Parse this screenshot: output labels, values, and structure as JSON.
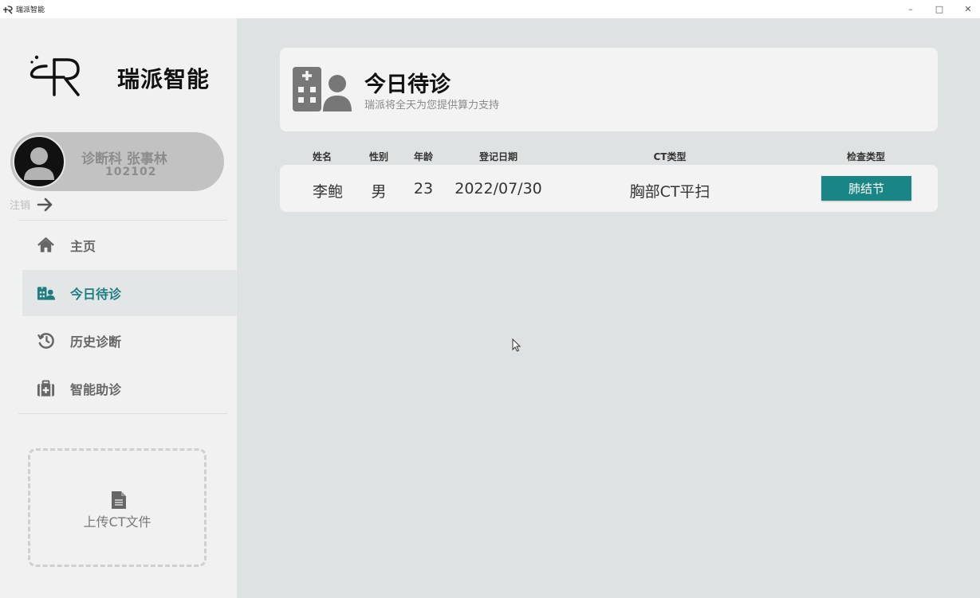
{
  "window": {
    "title": "瑞派智能",
    "controls": {
      "minimize": "–",
      "maximize": "□",
      "close": "✕"
    }
  },
  "sidebar": {
    "brand": "瑞派智能",
    "user": {
      "name": "诊断科 张事林",
      "id": "102102"
    },
    "logout_label": "注销",
    "nav": [
      {
        "label": "主页",
        "icon": "home-icon",
        "active": false
      },
      {
        "label": "今日待诊",
        "icon": "hospital-user-icon",
        "active": true
      },
      {
        "label": "历史诊断",
        "icon": "history-icon",
        "active": false
      },
      {
        "label": "智能助诊",
        "icon": "medkit-icon",
        "active": false
      }
    ],
    "upload_label": "上传CT文件"
  },
  "main": {
    "title": "今日待诊",
    "subtitle": "瑞派将全天为您提供算力支持",
    "table": {
      "headers": [
        "姓名",
        "性别",
        "年龄",
        "登记日期",
        "CT类型",
        "检查类型"
      ],
      "rows": [
        {
          "name": "李鲍",
          "gender": "男",
          "age": "23",
          "date": "2022/07/30",
          "ct_type": "胸部CT平扫",
          "exam_type": "肺结节"
        }
      ]
    }
  },
  "colors": {
    "accent": "#1a8585",
    "active_nav_text": "#1f7d80",
    "sidebar_bg": "#f1f1f1",
    "main_bg": "#dfe2e2",
    "card_bg": "#f3f3f3"
  }
}
